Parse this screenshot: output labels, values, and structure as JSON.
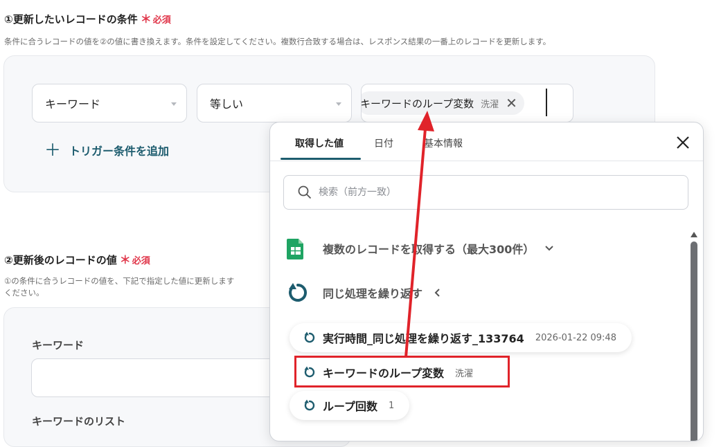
{
  "section1": {
    "title": "①更新したいレコードの条件",
    "required_label": "必須",
    "required_star": "＊",
    "description": "条件に合うレコードの値を②の値に書き換えます。条件を設定してください。複数行合致する場合は、レスポンス結果の一番上のレコードを更新します。",
    "field_select": "キーワード",
    "operator_select": "等しい",
    "value_chip": {
      "name": "キーワードのループ変数",
      "sub": "洗濯"
    },
    "add_trigger_label": "トリガー条件を追加"
  },
  "section2": {
    "title": "②更新後のレコードの値",
    "required_label": "必須",
    "required_star": "＊",
    "description_line1": "①の条件に合うレコードの値を、下記で指定した値に更新します",
    "description_line2": "ください。",
    "field1_label": "キーワード",
    "field1_value": "",
    "field2_label": "キーワードのリスト"
  },
  "popup": {
    "tabs": [
      {
        "label": "取得した値",
        "active": true
      },
      {
        "label": "日付",
        "active": false
      },
      {
        "label": "基本情報",
        "active": false
      }
    ],
    "search_placeholder": "検索（前方一致）",
    "groups": [
      {
        "label": "複数のレコードを取得する（最大300件）",
        "icon": "google-sheets-icon",
        "toggle": "chevron-down"
      },
      {
        "label": "同じ処理を繰り返す",
        "icon": "loop-icon",
        "toggle": "chevron-left"
      }
    ],
    "items": [
      {
        "name": "実行時間_同じ処理を繰り返す_133764",
        "value": "2026-01-22 09:48"
      },
      {
        "name": "キーワードのループ変数",
        "value": "洗濯"
      },
      {
        "name": "ループ回数",
        "value": "1"
      }
    ]
  },
  "colors": {
    "accent": "#1d5c6e",
    "required": "#e0364a",
    "annotation": "#e0232a",
    "sheets_green": "#1fa463"
  }
}
